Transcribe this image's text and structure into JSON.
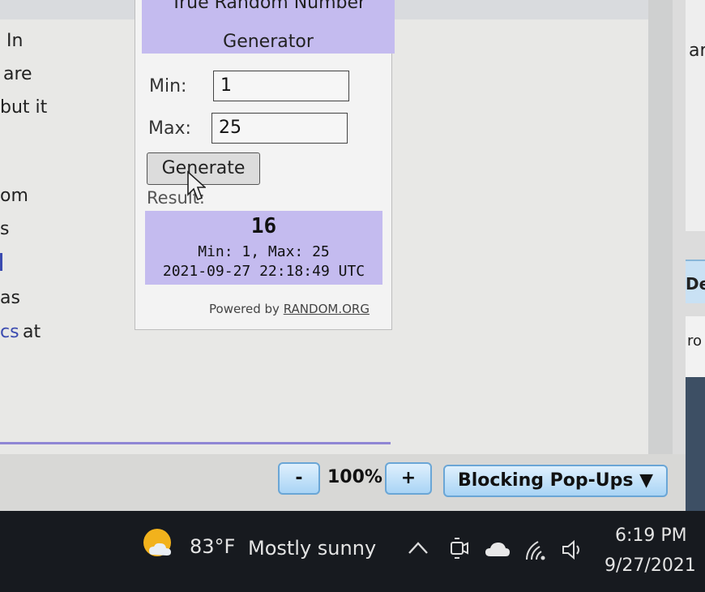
{
  "page": {
    "left_text": [
      "In",
      "are",
      "but it",
      "om",
      "s",
      "as",
      "cs",
      "at"
    ],
    "right_text": "ar",
    "right_tab_text": "De",
    "right_lower_text": "ro"
  },
  "widget": {
    "title_line1": "True Random Number",
    "title_line2": "Generator",
    "min_label": "Min:",
    "min_value": "1",
    "max_label": "Max:",
    "max_value": "25",
    "generate_label": "Generate",
    "result_label": "Result:",
    "result_number": "16",
    "result_minmax": "Min: 1, Max: 25",
    "result_timestamp": "2021-09-27 22:18:49 UTC",
    "powered_by": "Powered by",
    "powered_link": "RANDOM.ORG",
    "accent_color": "#c4bbef"
  },
  "statusbar": {
    "zoom_out_label": "-",
    "zoom_level": "100%",
    "zoom_in_label": "+",
    "popup_label": "Blocking Pop-Ups ▼"
  },
  "taskbar": {
    "weather_icon": "partly-sunny-icon",
    "temperature": "83°F",
    "weather_desc": "Mostly sunny",
    "time": "6:19 PM",
    "date": "9/27/2021"
  }
}
